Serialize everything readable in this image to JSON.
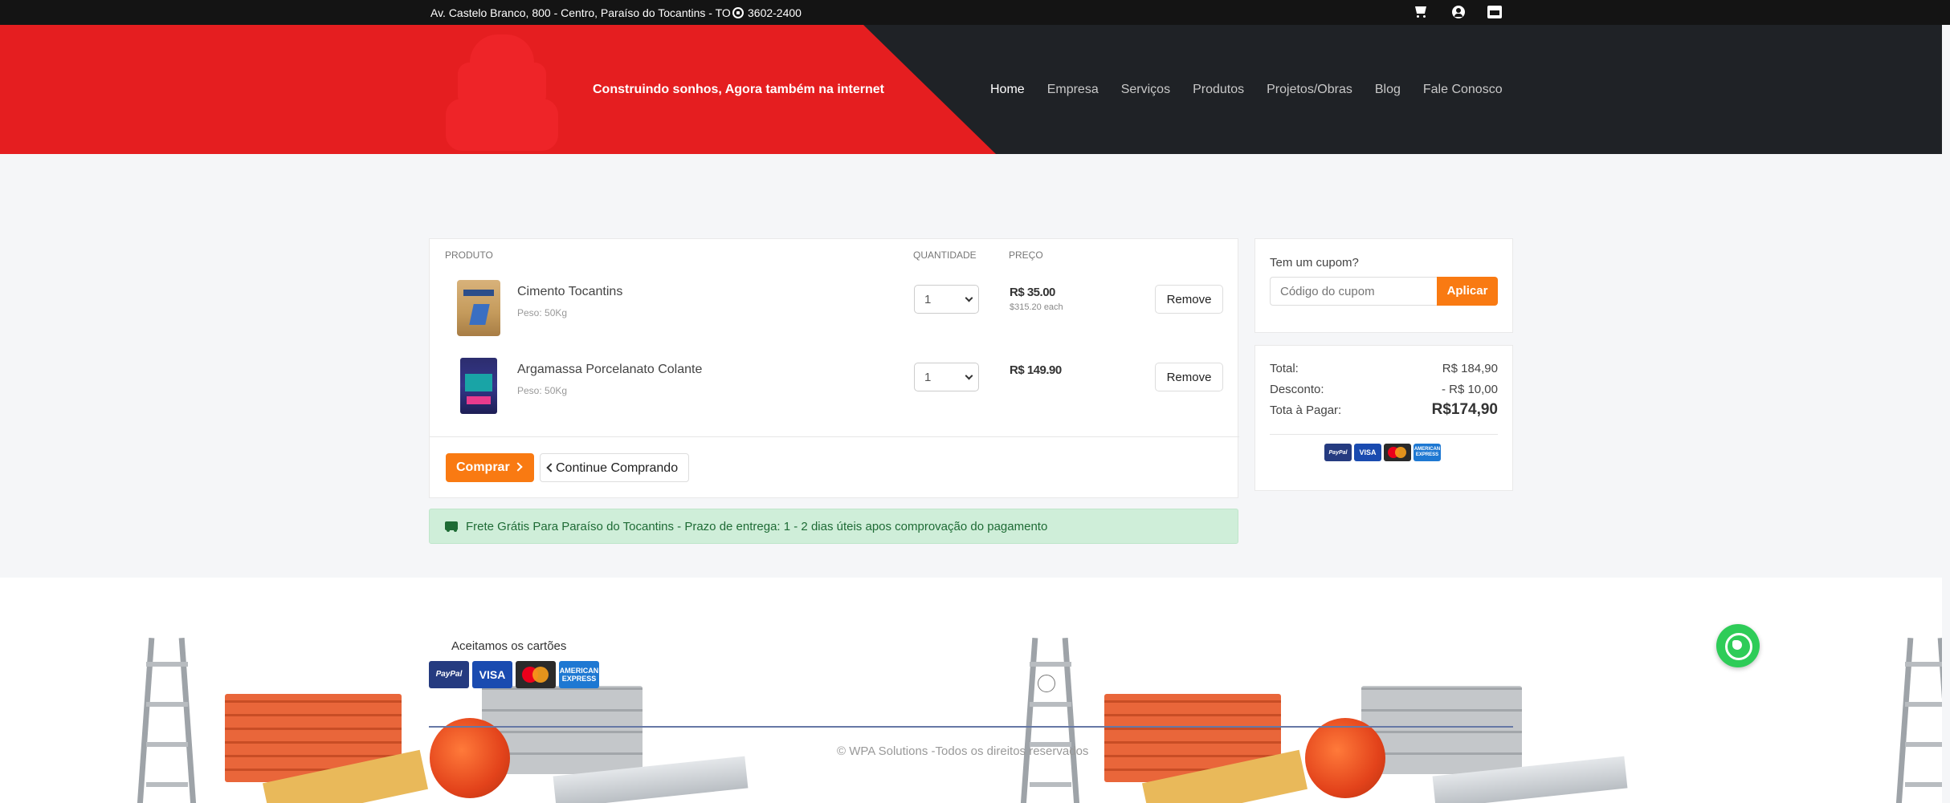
{
  "topbar": {
    "address": "Av. Castelo Branco, 800 - Centro, Paraíso do Tocantins - TO",
    "phone": "3602-2400",
    "icons": [
      "cart-icon",
      "user-icon",
      "store-icon"
    ]
  },
  "header": {
    "slogan": "Construindo sonhos, Agora também na internet",
    "nav": [
      "Home",
      "Empresa",
      "Serviços",
      "Produtos",
      "Projetos/Obras",
      "Blog",
      "Fale Conosco"
    ],
    "active_nav": "Home"
  },
  "cart": {
    "headers": {
      "product": "PRODUTO",
      "quantity": "QUANTIDADE",
      "price": "PREÇO"
    },
    "items": [
      {
        "name": "Cimento Tocantins",
        "weight": "Peso: 50Kg",
        "quantity": "1",
        "price": "R$ 35.00",
        "each": "$315.20 each",
        "remove": "Remove"
      },
      {
        "name": "Argamassa Porcelanato Colante",
        "weight": "Peso: 50Kg",
        "quantity": "1",
        "price": "R$ 149.90",
        "each": "",
        "remove": "Remove"
      }
    ],
    "buy_label": "Comprar",
    "continue_label": "Continue Comprando"
  },
  "shipping": {
    "text": "Frete Grátis Para Paraíso do Tocantins - Prazo de entrega: 1 - 2 dias úteis apos comprovação do pagamento"
  },
  "coupon": {
    "label": "Tem um cupom?",
    "placeholder": "Código do cupom",
    "apply_label": "Aplicar"
  },
  "totals": {
    "total_label": "Total:",
    "total_value": "R$ 184,90",
    "discount_label": "Desconto:",
    "discount_value": "- R$ 10,00",
    "pay_label": "Tota à Pagar:",
    "pay_value": "R$174,90"
  },
  "payment_cards": {
    "paypal": "PayPal",
    "visa": "VISA",
    "amex": "AMERICAN EXPRESS"
  },
  "footer": {
    "cards_label": "Aceitamos os cartões",
    "copyright": "© WPA Solutions -Todos os direitos reservados"
  },
  "colors": {
    "header_red": "#e51e20",
    "header_dark": "#1f2226",
    "accent_orange": "#f97a12",
    "shipping_green": "#cfeed9",
    "whatsapp_green": "#2ecc58"
  }
}
